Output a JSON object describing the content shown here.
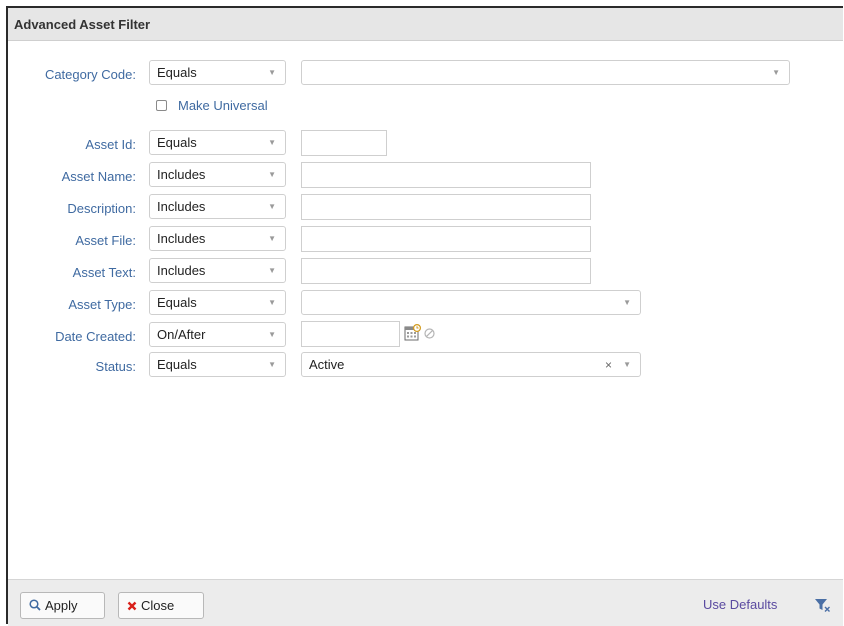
{
  "dialog": {
    "title": "Advanced Asset Filter"
  },
  "category": {
    "label": "Category Code:",
    "operator": "Equals",
    "value": "",
    "make_universal_label": "Make Universal"
  },
  "fields": [
    {
      "label": "Asset Id:",
      "operator": "Equals",
      "value": ""
    },
    {
      "label": "Asset Name:",
      "operator": "Includes",
      "value": ""
    },
    {
      "label": "Description:",
      "operator": "Includes",
      "value": ""
    },
    {
      "label": "Asset File:",
      "operator": "Includes",
      "value": ""
    },
    {
      "label": "Asset Text:",
      "operator": "Includes",
      "value": ""
    },
    {
      "label": "Asset Type:",
      "operator": "Equals",
      "value": ""
    },
    {
      "label": "Date Created:",
      "operator": "On/After",
      "value": ""
    },
    {
      "label": "Status:",
      "operator": "Equals",
      "value": "Active"
    }
  ],
  "icons": {
    "dropdown": "▼",
    "calendar": "calendar-icon",
    "clear_date": "clear-icon",
    "clear_status": "×",
    "apply": "search-icon",
    "close": "close-icon",
    "filter_clear": "filter-clear-icon"
  },
  "footer": {
    "apply_label": "Apply",
    "close_label": "Close",
    "use_defaults_label": "Use Defaults"
  },
  "colors": {
    "label": "#3f6aa1",
    "close_x": "#d9201a",
    "link": "#5a4aa0",
    "filter_icon": "#4a6fa5"
  }
}
